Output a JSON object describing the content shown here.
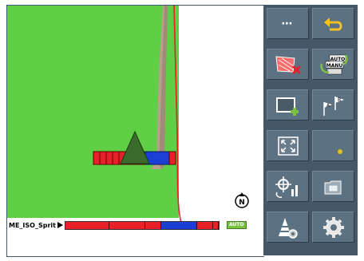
{
  "implement": {
    "name": "ME_ISO_Sprit",
    "auto_label": "AUTO",
    "sections": [
      {
        "color": "#e8202a",
        "weight": 55
      },
      {
        "color": "#e8202a",
        "weight": 45
      },
      {
        "color": "#e8202a",
        "weight": 20
      },
      {
        "color": "#1b3fd4",
        "weight": 45
      },
      {
        "color": "#e8202a",
        "weight": 20
      },
      {
        "color": "#e8202a",
        "weight": 7
      }
    ]
  },
  "toolbar": {
    "menu_label": "⋯",
    "buttons": [
      {
        "name": "menu-button",
        "icon": "more-icon"
      },
      {
        "name": "back-button",
        "icon": "return-arrow-icon"
      },
      {
        "name": "delete-field-button",
        "icon": "field-delete-icon"
      },
      {
        "name": "auto-manual-button",
        "icon": "auto-manual-icon",
        "text_auto": "AUTO",
        "text_manu": "MANU"
      },
      {
        "name": "add-boundary-button",
        "icon": "boundary-add-icon"
      },
      {
        "name": "ab-line-button",
        "icon": "ab-flags-icon",
        "text_a": "A",
        "text_b": "B"
      },
      {
        "name": "zoom-extents-button",
        "icon": "zoom-extents-icon"
      },
      {
        "name": "warning-button",
        "icon": "warning-dot-icon"
      },
      {
        "name": "gps-stats-button",
        "icon": "gps-chart-icon"
      },
      {
        "name": "folder-button",
        "icon": "folder-icon"
      },
      {
        "name": "tool-settings-button",
        "icon": "cone-gear-icon"
      },
      {
        "name": "settings-button",
        "icon": "gear-icon"
      }
    ]
  },
  "colors": {
    "field": "#5fcf45",
    "boundary": "#e8202a",
    "track": "#b8a08c",
    "panel": "#455868",
    "button": "#5c7182"
  }
}
